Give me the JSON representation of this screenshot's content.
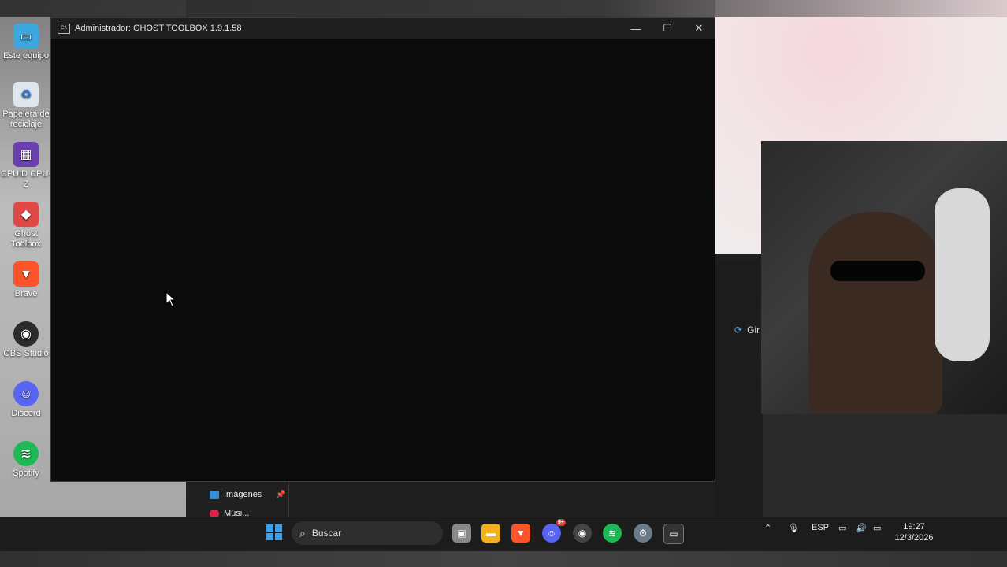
{
  "console": {
    "title": "Administrador:  GHOST TOOLBOX 1.9.1.58",
    "icon_label": "C:\\",
    "minimize": "—",
    "maximize": "☐",
    "close": "✕"
  },
  "desktop_icons": [
    {
      "label": "Este equipo",
      "icon": "monitor-icon",
      "color": "#3aa7e0"
    },
    {
      "label": "Papelera de reciclaje",
      "icon": "recycle-bin-icon",
      "color": "#dfe6ee"
    },
    {
      "label": "CPUID CPU-Z",
      "icon": "cpu-z-icon",
      "color": "#6a3fb0"
    },
    {
      "label": "Ghost Toolbox",
      "icon": "ghost-toolbox-icon",
      "color": "#e04848"
    },
    {
      "label": "Brave",
      "icon": "brave-icon",
      "color": "#fb542b"
    },
    {
      "label": "OBS Studio",
      "icon": "obs-icon",
      "color": "#2b2b2b"
    },
    {
      "label": "Discord",
      "icon": "discord-icon",
      "color": "#5865f2"
    },
    {
      "label": "Spotify",
      "icon": "spotify-icon",
      "color": "#1db954"
    }
  ],
  "explorer": {
    "images_label": "Imágenes",
    "music_label": "Músi...",
    "rotate_label": "Gir"
  },
  "taskbar": {
    "search_placeholder": "Buscar",
    "apps": [
      {
        "name": "task-view",
        "color": "#888"
      },
      {
        "name": "file-explorer",
        "color": "#f2b01e"
      },
      {
        "name": "brave",
        "color": "#fb542b"
      },
      {
        "name": "discord",
        "color": "#5865f2",
        "badge": "9+"
      },
      {
        "name": "obs",
        "color": "#444"
      },
      {
        "name": "spotify",
        "color": "#1db954"
      },
      {
        "name": "settings",
        "color": "#6a7a8a"
      },
      {
        "name": "terminal",
        "color": "#333"
      }
    ],
    "language": "ESP",
    "time": "19:27",
    "date": "12/3/2026"
  }
}
